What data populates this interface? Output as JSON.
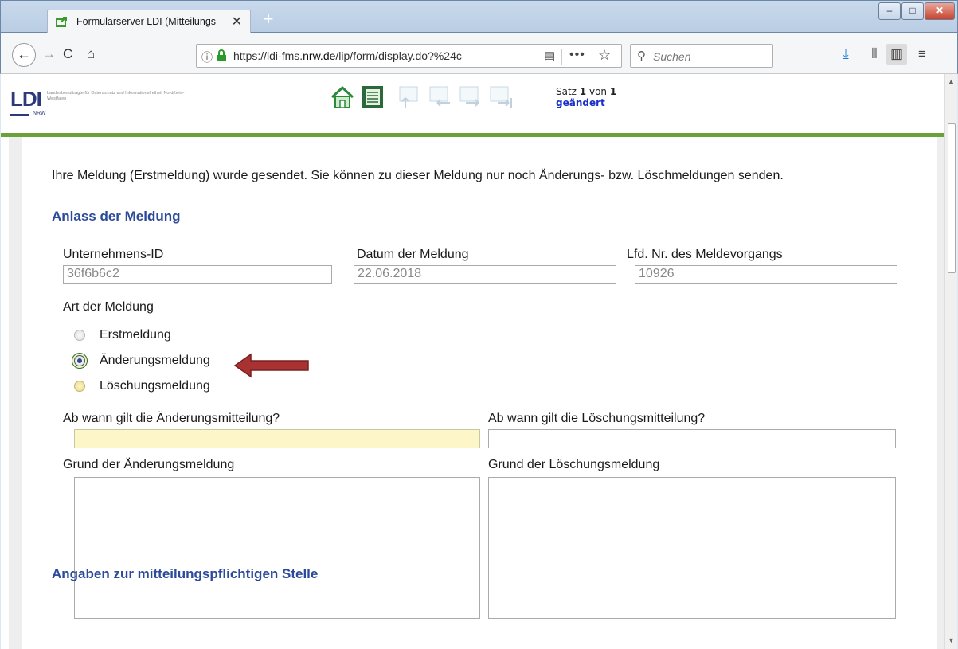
{
  "browser": {
    "tab_title": "Formularserver LDI (Mitteilungs",
    "tab_close": "✕",
    "new_tab": "+",
    "url_prefix": "https://ldi-fms.",
    "url_domain": "nrw.de",
    "url_rest": "/lip/form/display.do?%24c",
    "search_placeholder": "Suchen",
    "window_controls": {
      "minimize": "–",
      "maximize": "□",
      "close": "✕"
    },
    "icons": [
      "back-icon",
      "forward-icon",
      "reload-icon",
      "home-icon",
      "info-icon",
      "lock-icon",
      "reader-view-icon",
      "more-icon",
      "bookmark-star-icon",
      "search-icon",
      "download-icon",
      "library-icon",
      "sidebar-icon",
      "menu-icon"
    ]
  },
  "app": {
    "logo_text": "LDI",
    "logo_nrw": "NRW",
    "logo_subtitle": "Landesbeauftragte für Datenschutz und Informationsfreiheit Nordrhein-Westfalen",
    "record_label": "Satz ",
    "record_current": "1",
    "record_of": " von ",
    "record_total": "1",
    "record_status": "geändert",
    "toolbar_icons": [
      "home-icon",
      "form-list-icon",
      "first-record-icon",
      "previous-record-icon",
      "next-record-icon",
      "last-record-icon"
    ],
    "brand_green": "#6aa138",
    "accent_blue": "#2b4a9a"
  },
  "form": {
    "notice": "Ihre Meldung (Erstmeldung) wurde gesendet. Sie können zu dieser Meldung nur noch Änderungs- bzw. Löschmeldungen senden.",
    "section_title": "Anlass der Meldung",
    "company_id_label": "Unternehmens-ID",
    "company_id_value": "36f6b6c2",
    "date_label": "Datum der Meldung",
    "date_value": "22.06.2018",
    "seq_label": "Lfd. Nr. des Meldevorgangs",
    "seq_value": "10926",
    "report_type_label": "Art der Meldung",
    "report_types": [
      {
        "label": "Erstmeldung",
        "selected": false
      },
      {
        "label": "Änderungsmeldung",
        "selected": true
      },
      {
        "label": "Löschungsmeldung",
        "selected": false
      }
    ],
    "change_date_label": "Ab wann gilt die Änderungsmitteilung?",
    "delete_date_label": "Ab wann gilt die Löschungsmitteilung?",
    "change_reason_label": "Grund der Änderungsmeldung",
    "delete_reason_label": "Grund der Löschungsmeldung",
    "next_section_title": "Angaben zur mitteilungspflichtigen Stelle",
    "arrow_color": "#a83232",
    "highlight_color": "#fdf6c8"
  }
}
